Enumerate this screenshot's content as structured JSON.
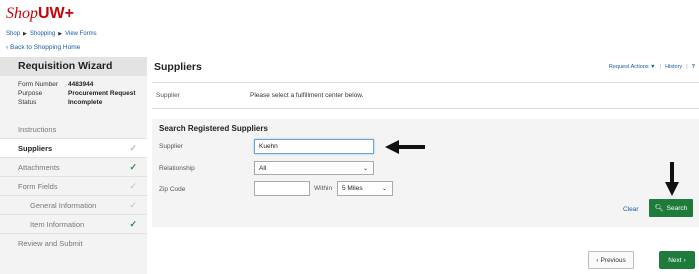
{
  "app": {
    "logo_shop": "Shop",
    "logo_uw": "UW+"
  },
  "breadcrumbs": [
    "Shop",
    "Shopping",
    "View Forms"
  ],
  "back_link": "Back to Shopping Home",
  "sidebar": {
    "title": "Requisition Wizard",
    "meta": [
      {
        "label": "Form Number",
        "value": "4483944"
      },
      {
        "label": "Purpose",
        "value": "Procurement Request"
      },
      {
        "label": "Status",
        "value": "Incomplete"
      }
    ],
    "items": [
      {
        "label": "Instructions",
        "check": ""
      },
      {
        "label": "Suppliers",
        "check": "✓"
      },
      {
        "label": "Attachments",
        "check": "✓"
      },
      {
        "label": "Form Fields",
        "check": "✓"
      },
      {
        "label": "General Information",
        "check": "✓"
      },
      {
        "label": "Item Information",
        "check": "✓"
      },
      {
        "label": "Review and Submit",
        "check": ""
      }
    ]
  },
  "main": {
    "title": "Suppliers",
    "actions": {
      "request_actions": "Request Actions",
      "history": "History",
      "help": "?"
    },
    "supplier_label": "Supplier",
    "supplier_message": "Please select a fulfillment center below.",
    "search": {
      "title": "Search Registered Suppliers",
      "supplier_label": "Supplier",
      "supplier_value": "Kuehn",
      "relationship_label": "Relationship",
      "relationship_value": "All",
      "zip_label": "Zip Code",
      "zip_value": "",
      "within_label": "Within",
      "within_value": "5 Miles",
      "clear_label": "Clear",
      "search_label": "Search"
    },
    "previous_label": "Previous",
    "next_label": "Next"
  },
  "colors": {
    "brand": "#c5050c",
    "accent": "#1e7b3b",
    "link": "#1a5aa6"
  }
}
